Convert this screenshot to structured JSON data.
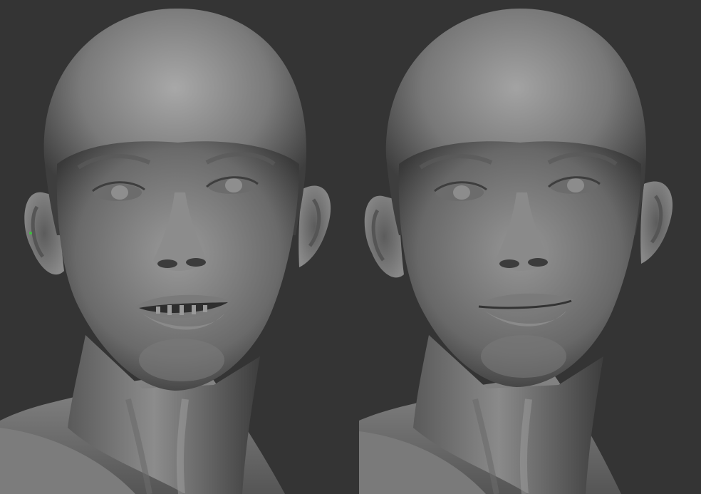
{
  "image": {
    "description_panels": [
      "left-render",
      "right-render"
    ],
    "colors": {
      "background": "#333333",
      "skin_light": "#9a9a9a",
      "skin_mid": "#6e6e6e",
      "skin_dark": "#3a3a3a",
      "accent_point": "#3fbf3f"
    }
  }
}
